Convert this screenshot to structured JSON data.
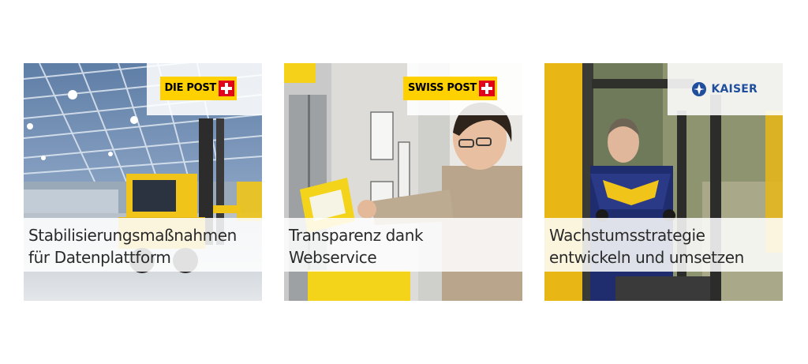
{
  "cards": [
    {
      "logo": "DIE POST",
      "logo_icon": "swiss-cross-icon",
      "caption_line1": "Stabilisierungsmaßnahmen",
      "caption_line2": "für Datenplattform"
    },
    {
      "logo": "SWISS POST",
      "logo_icon": "swiss-cross-icon",
      "caption_line1": "Transparenz dank",
      "caption_line2": "Webservice"
    },
    {
      "logo": "KAISER",
      "logo_icon": "kaiser-emblem-icon",
      "caption_line1": "Wachstumsstrategie",
      "caption_line2": "entwickeln und umsetzen"
    }
  ],
  "colors": {
    "post_yellow": "#ffd100",
    "post_red": "#e2001a",
    "kaiser_blue": "#1f4f9c",
    "caption_text": "#2a2a2a"
  }
}
